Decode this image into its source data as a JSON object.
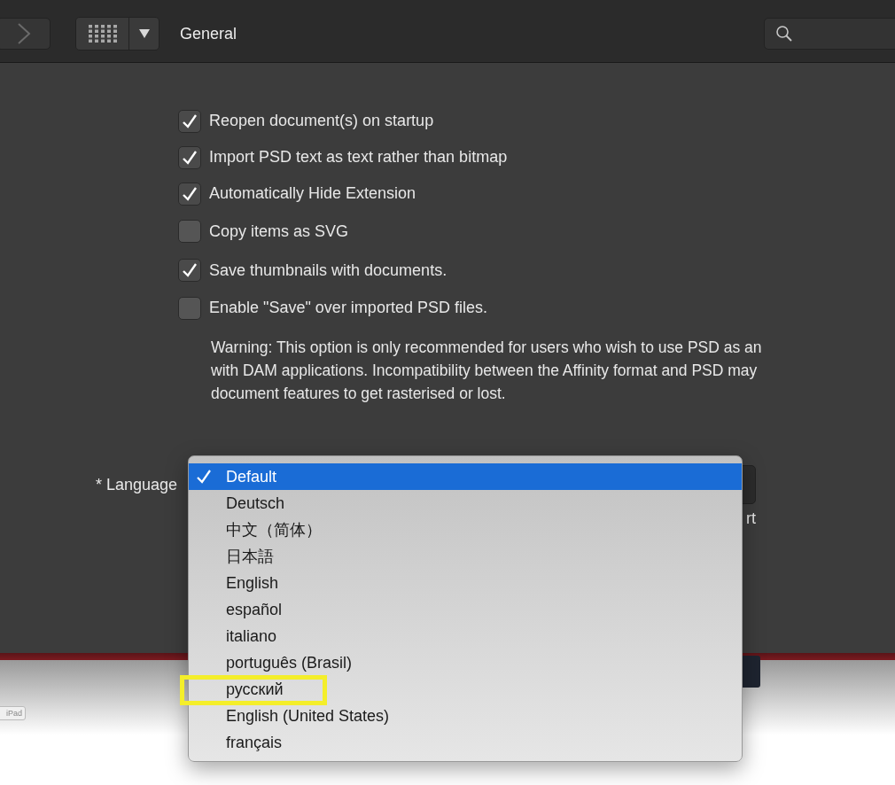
{
  "toolbar": {
    "title": "General"
  },
  "options": [
    {
      "label": "Reopen document(s) on startup",
      "checked": true
    },
    {
      "label": "Import PSD text as text rather than bitmap",
      "checked": true
    },
    {
      "label": "Automatically Hide Extension",
      "checked": true
    },
    {
      "label": "Copy items as SVG",
      "checked": false
    },
    {
      "label": "Save thumbnails with documents.",
      "checked": true
    },
    {
      "label": "Enable \"Save\" over imported PSD files.",
      "checked": false
    }
  ],
  "warning_lines": [
    "Warning: This option is only recommended for users who wish to use PSD as an",
    "with DAM applications. Incompatibility between the Affinity format and PSD may",
    "document features to get rasterised or lost."
  ],
  "language": {
    "label": "* Language",
    "note": "rt"
  },
  "language_menu": {
    "items": [
      {
        "label": "Default",
        "selected": true,
        "highlighted": false
      },
      {
        "label": "Deutsch",
        "selected": false,
        "highlighted": false
      },
      {
        "label": "中文（简体）",
        "selected": false,
        "highlighted": false
      },
      {
        "label": "日本語",
        "selected": false,
        "highlighted": false
      },
      {
        "label": "English",
        "selected": false,
        "highlighted": false
      },
      {
        "label": "español",
        "selected": false,
        "highlighted": false
      },
      {
        "label": "italiano",
        "selected": false,
        "highlighted": false
      },
      {
        "label": "português (Brasil)",
        "selected": false,
        "highlighted": false
      },
      {
        "label": "русский",
        "selected": false,
        "highlighted": true
      },
      {
        "label": "English (United States)",
        "selected": false,
        "highlighted": false
      },
      {
        "label": "français",
        "selected": false,
        "highlighted": false
      }
    ]
  },
  "background": {
    "tag": "iPad"
  }
}
